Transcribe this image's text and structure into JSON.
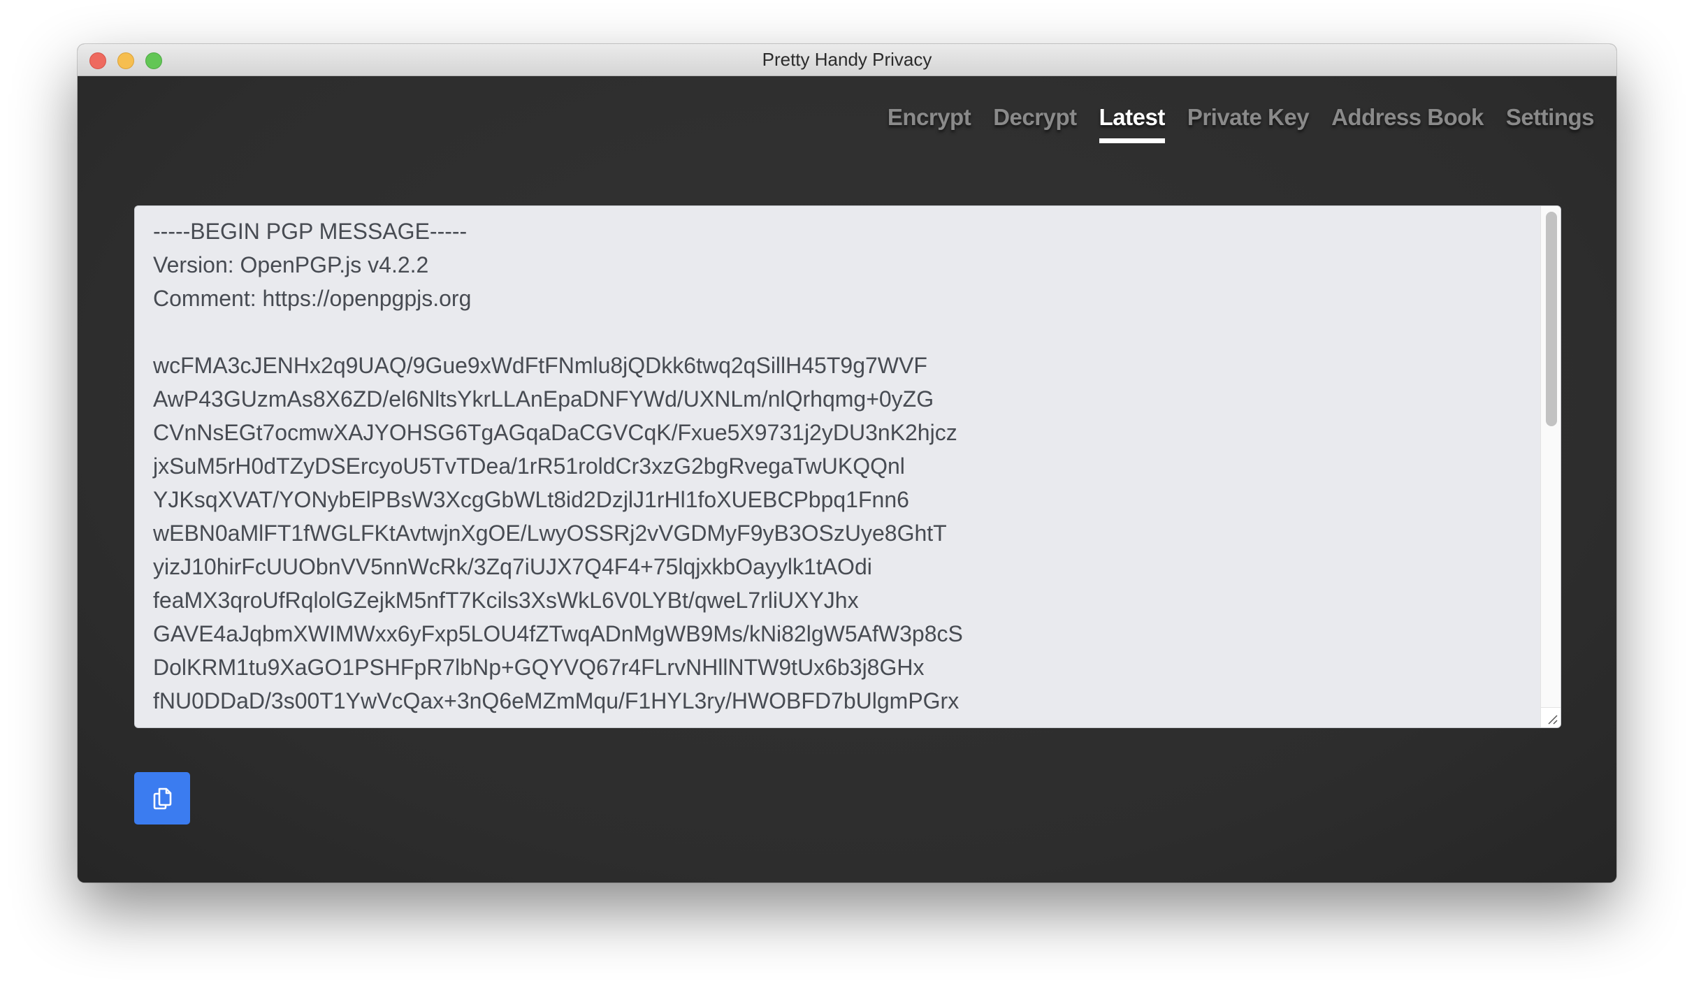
{
  "window": {
    "title": "Pretty Handy Privacy",
    "controls": [
      "close",
      "minimize",
      "maximize"
    ]
  },
  "nav": {
    "items": [
      {
        "label": "Encrypt",
        "active": false
      },
      {
        "label": "Decrypt",
        "active": false
      },
      {
        "label": "Latest",
        "active": true
      },
      {
        "label": "Private Key",
        "active": false
      },
      {
        "label": "Address Book",
        "active": false
      },
      {
        "label": "Settings",
        "active": false
      }
    ]
  },
  "message": {
    "lines": [
      "-----BEGIN PGP MESSAGE-----",
      "Version: OpenPGP.js v4.2.2",
      "Comment: https://openpgpjs.org",
      "",
      "wcFMA3cJENHx2q9UAQ/9Gue9xWdFtFNmlu8jQDkk6twq2qSillH45T9g7WVF",
      "AwP43GUzmAs8X6ZD/el6NltsYkrLLAnEpaDNFYWd/UXNLm/nlQrhqmg+0yZG",
      "CVnNsEGt7ocmwXAJYOHSG6TgAGqaDaCGVCqK/Fxue5X9731j2yDU3nK2hjcz",
      "jxSuM5rH0dTZyDSErcyoU5TvTDea/1rR51roldCr3xzG2bgRvegaTwUKQQnl",
      "YJKsqXVAT/YONybElPBsW3XcgGbWLt8id2DzjlJ1rHl1foXUEBCPbpq1Fnn6",
      "wEBN0aMlFT1fWGLFKtAvtwjnXgOE/LwyOSSRj2vVGDMyF9yB3OSzUye8GhtT",
      "yizJ10hirFcUUObnVV5nnWcRk/3Zq7iUJX7Q4F4+75lqjxkbOayylk1tAOdi",
      "feaMX3qroUfRqlolGZejkM5nfT7Kcils3XsWkL6V0LYBt/qweL7rliUXYJhx",
      "GAVE4aJqbmXWIMWxx6yFxp5LOU4fZTwqADnMgWB9Ms/kNi82lgW5AfW3p8cS",
      "DolKRM1tu9XaGO1PSHFpR7lbNp+GQYVQ67r4FLrvNHllNTW9tUx6b3j8GHx",
      "fNU0DDaD/3s00T1YwVcQax+3nQ6eMZmMqu/F1HYL3ry/HWOBFD7bUlgmPGrx"
    ]
  },
  "scrollbar": {
    "position_fraction": 0.0,
    "visible_fraction": 0.42
  },
  "actions": {
    "copy_icon": "copy-icon",
    "accent_color": "#3b7cf0"
  }
}
